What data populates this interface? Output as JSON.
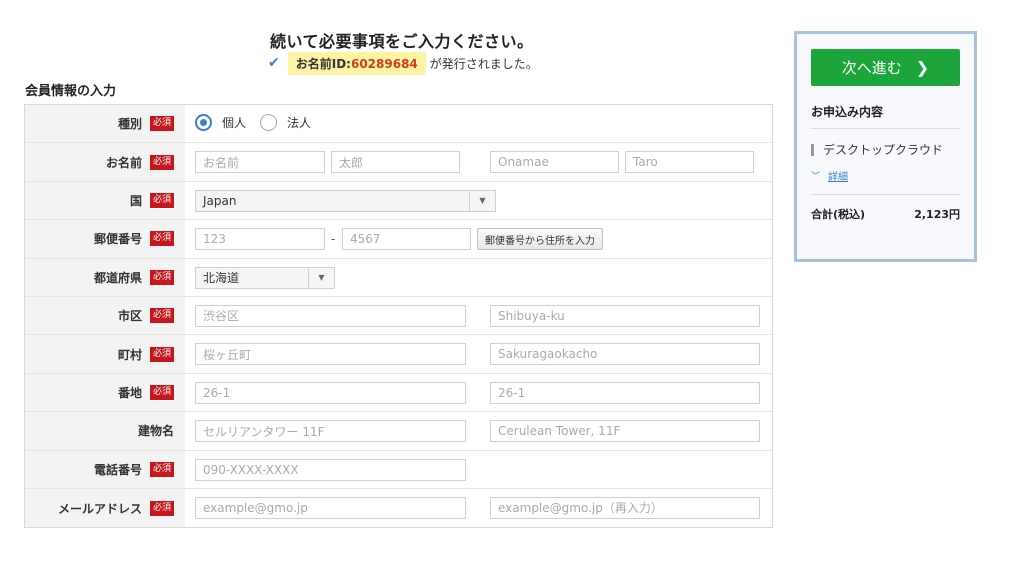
{
  "header": {
    "headline": "続いて必要事項をご入力ください。",
    "id_label": "お名前ID:",
    "id_value": "60289684",
    "issued_suffix": "が発行されました。"
  },
  "section_title": "会員情報の入力",
  "required_badge": "必須",
  "form": {
    "type": {
      "label": "種別",
      "options": [
        "個人",
        "法人"
      ],
      "selected": "個人"
    },
    "name": {
      "label": "お名前",
      "placeholders": [
        "お名前",
        "太郎",
        "Onamae",
        "Taro"
      ]
    },
    "country": {
      "label": "国",
      "value": "Japan"
    },
    "postal": {
      "label": "郵便番号",
      "placeholders": [
        "123",
        "4567"
      ],
      "separator": "-",
      "lookup_button": "郵便番号から住所を入力"
    },
    "prefecture": {
      "label": "都道府県",
      "value": "北海道"
    },
    "city": {
      "label": "市区",
      "placeholders": [
        "渋谷区",
        "Shibuya-ku"
      ]
    },
    "town": {
      "label": "町村",
      "placeholders": [
        "桜ヶ丘町",
        "Sakuragaokacho"
      ]
    },
    "block": {
      "label": "番地",
      "placeholders": [
        "26-1",
        "26-1"
      ]
    },
    "building": {
      "label": "建物名",
      "placeholders": [
        "セルリアンタワー 11F",
        "Cerulean Tower, 11F"
      ]
    },
    "phone": {
      "label": "電話番号",
      "placeholders": [
        "090-XXXX-XXXX"
      ]
    },
    "email": {
      "label": "メールアドレス",
      "placeholders": [
        "example@gmo.jp",
        "example@gmo.jp（再入力）"
      ]
    }
  },
  "sidebar": {
    "next_button": "次へ進む",
    "next_chevron": "❯",
    "order_title": "お申込み内容",
    "plan_name": "デスクトップクラウド",
    "detail_link": "詳細",
    "total_label": "合計(税込)",
    "total_value": "2,123円"
  },
  "icons": {
    "check": "check-icon",
    "caret": "caret-down-icon",
    "chevron_right": "chevron-right-icon",
    "chevron_down": "chevron-down-icon"
  },
  "colors": {
    "accent_blue": "#3a7bd5",
    "required_red": "#c8161d",
    "id_highlight": "#fdf3a5",
    "id_number": "#d13b1f",
    "next_green": "#1ba53a",
    "sidebar_border": "#a9c0df"
  }
}
